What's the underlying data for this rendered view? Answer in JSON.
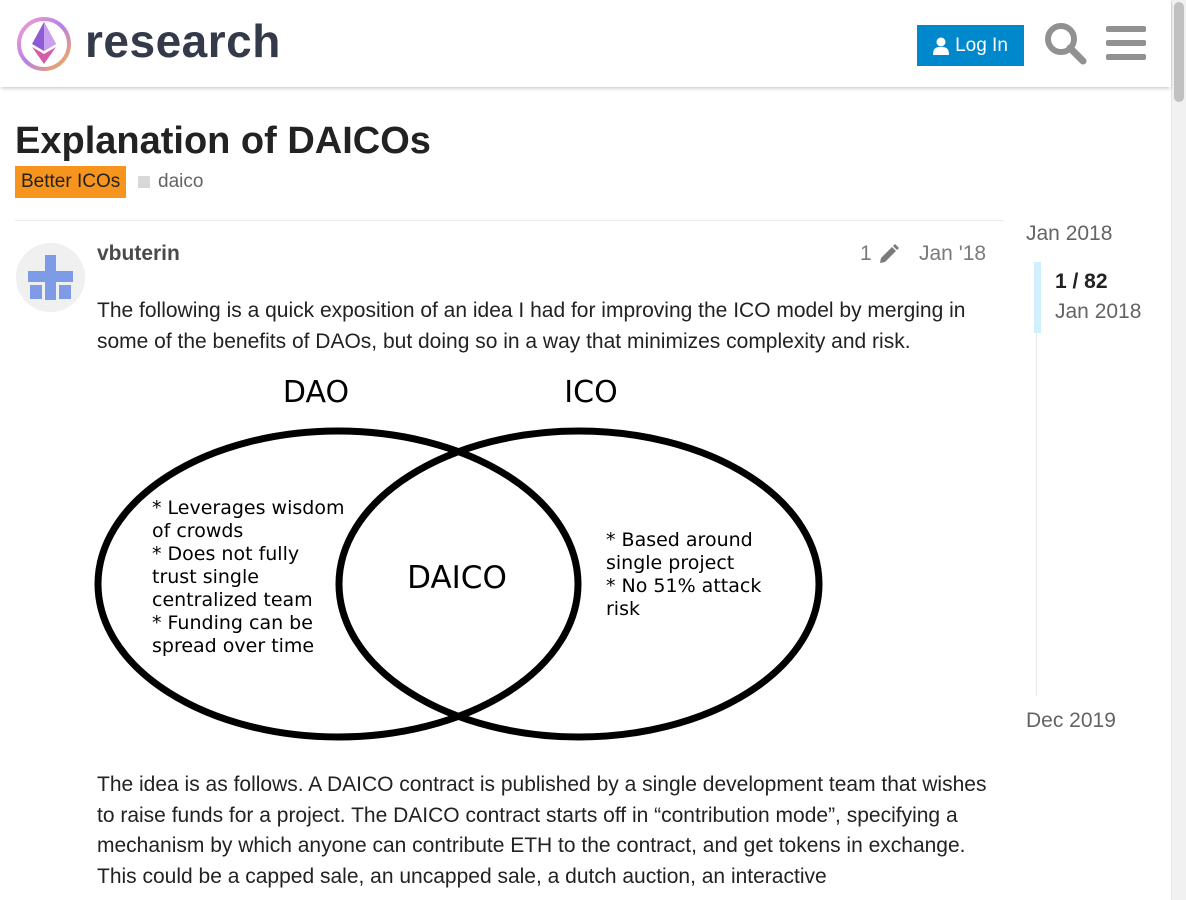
{
  "header": {
    "site_name": "research",
    "login_label": "Log In"
  },
  "topic": {
    "title": "Explanation of DAICOs",
    "category": "Better ICOs",
    "tag": "daico"
  },
  "post": {
    "author": "vbuterin",
    "edit_count": "1",
    "date": "Jan '18",
    "paragraph1": "The following is a quick exposition of an idea I had for improving the ICO model by merging in some of the benefits of DAOs, but doing so in a way that minimizes complexity and risk.",
    "paragraph2": "The idea is as follows. A DAICO contract is published by a single development team that wishes to raise funds for a project. The DAICO contract starts off in “contribution mode”, specifying a mechanism by which anyone can contribute ETH to the contract, and get tokens in exchange. This could be a capped sale, an uncapped sale, a dutch auction, an interactive",
    "diagram": {
      "left_title": "DAO",
      "right_title": "ICO",
      "center_label": "DAICO",
      "left_lines": [
        "* Leverages wisdom",
        "of  crowds",
        "* Does not fully",
        "trust single",
        "centralized team",
        "* Funding can be",
        "spread over time"
      ],
      "right_lines": [
        "* Based around",
        "single project",
        "* No 51% attack",
        "risk"
      ]
    }
  },
  "timeline": {
    "start": "Jan 2018",
    "position": "1 / 82",
    "position_date": "Jan 2018",
    "end": "Dec 2019"
  },
  "colors": {
    "accent": "#0088cc",
    "category": "#f7941d",
    "timeline_handle": "#d1f0ff"
  }
}
